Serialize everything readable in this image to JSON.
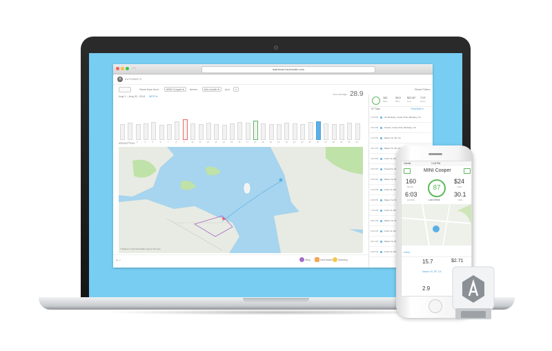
{
  "browser": {
    "url": "dashboard.automatic.com",
    "app_name": "AUTOMATIC",
    "filter": {
      "prefix": "Show trips from",
      "vehicle": "MINI Cooper",
      "driven": "driven",
      "period": "this month",
      "and": "and",
      "plus": "+",
      "reset": "Reset Filters"
    },
    "date_range": "Aug 1 – Aug 31, 2014",
    "metric_select": "MPG",
    "month_label": "AUGUST 2014",
    "avg_label": "Your average",
    "avg_value": "28.9",
    "bar_day_labels": [
      "1",
      "2",
      "3",
      "4",
      "5",
      "6",
      "7",
      "8",
      "9",
      "10",
      "11",
      "12",
      "13",
      "14",
      "15",
      "16",
      "17",
      "18",
      "19",
      "20",
      "21",
      "22",
      "23",
      "24",
      "25",
      "26",
      "27",
      "28",
      "29",
      "30",
      "31"
    ],
    "map_attribution": "© Mapbox © OpenStreetMap Improve this map",
    "legend": [
      "Idling",
      "Hard Brakes",
      "Speeding"
    ],
    "select_all": "Select all"
  },
  "chart_data": {
    "type": "bar",
    "categories": [
      "1",
      "2",
      "3",
      "4",
      "5",
      "6",
      "7",
      "8",
      "9",
      "10",
      "11",
      "12",
      "13",
      "14",
      "15",
      "16",
      "17",
      "18",
      "19",
      "20",
      "21",
      "22",
      "23",
      "24",
      "25",
      "26",
      "27",
      "28",
      "29",
      "30",
      "31"
    ],
    "values": [
      26,
      28,
      25,
      27,
      29,
      24,
      26,
      30,
      33,
      27,
      25,
      28,
      26,
      24,
      27,
      29,
      28,
      31,
      27,
      26,
      25,
      28,
      27,
      26,
      29,
      30,
      27,
      25,
      26,
      28,
      27
    ],
    "highlight": {
      "red": [
        9
      ],
      "green": [
        18
      ],
      "blue": [
        26
      ]
    }
  },
  "trips": {
    "summary": [
      {
        "value": "161",
        "label": "Miles"
      },
      {
        "value": "28.9",
        "label": "MPG"
      },
      {
        "value": "$22.87",
        "label": "Fuel"
      },
      {
        "value": "7:07",
        "label": "Hours"
      }
    ],
    "count": "37 Trips",
    "sort": "Time/Date",
    "rows": [
      {
        "time": "2:10 PM",
        "place": "UC Berkeley, Cesar Chav, Berkeley, CA"
      },
      {
        "time": "3:04 PM",
        "place": "Ouotris, Cesar Chav, Berkeley, CA"
      },
      {
        "time": "3:13 PM",
        "place": "Mason St, SF, CA"
      },
      {
        "time": "4:01 PM",
        "place": "Mason St, SF, CA"
      },
      {
        "time": "4:22 PM",
        "place": "Union St, SF, CA"
      },
      {
        "time": "5:05 PM",
        "place": "Powell St, SF, CA"
      },
      {
        "time": "5:30 PM",
        "place": "Mason St, SF, CA"
      },
      {
        "time": "6:10 PM",
        "place": "Union St, SF, CA"
      },
      {
        "time": "6:48 PM",
        "place": "Mason St, SF, CA"
      },
      {
        "time": "7:15 PM",
        "place": "Union St, SF, CA"
      },
      {
        "time": "8:02 PM",
        "place": "Mason St, SF, CA"
      },
      {
        "time": "8:30 PM",
        "place": "Union St, SF, CA"
      },
      {
        "time": "9:01 PM",
        "place": "Mason St, SF, CA"
      },
      {
        "time": "9:40 PM",
        "place": "Union St, SF, CA"
      }
    ]
  },
  "phone": {
    "carrier": "Carrier",
    "time": "1:18 PM",
    "title": "MINI Cooper",
    "miles": "160",
    "miles_label": "MILES",
    "cost": "$24",
    "cost_label": "FUEL",
    "score": "87",
    "hours": "6:03",
    "hours_label": "HOURS",
    "mpg": "30.1",
    "mpg_label": "MPG",
    "week": "Last Week",
    "trip_miles": "15.7",
    "trip_cost": "$2.71",
    "trip_to": "Mason St, SF, CA",
    "trip2": "2.9",
    "home": "Home"
  },
  "colors": {
    "accent": "#5cb85c",
    "blue": "#5ab0e6",
    "screen_bg": "#77cdf2"
  }
}
